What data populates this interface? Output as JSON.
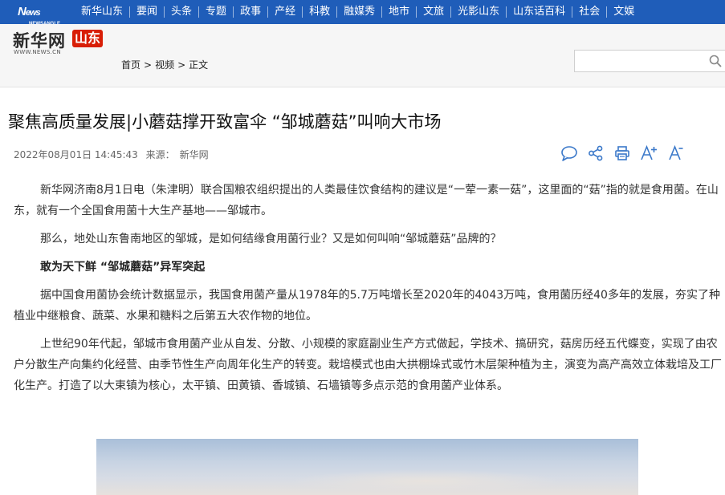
{
  "top_nav": {
    "logo": "NewsAngle",
    "items": [
      "新华山东",
      "要闻",
      "头条",
      "专题",
      "政事",
      "产经",
      "科教",
      "融媒秀",
      "地市",
      "文旅",
      "光影山东",
      "山东话百科",
      "社会",
      "文娱"
    ]
  },
  "header": {
    "brand_name": "新华网",
    "brand_region": "山东",
    "brand_url": "WWW.NEWS.CN",
    "breadcrumb": [
      "首页",
      "视频",
      "正文"
    ],
    "breadcrumb_sep": ">",
    "search_placeholder": ""
  },
  "article": {
    "title": "聚焦高质量发展|小蘑菇撑开致富伞 “邹城蘑菇”叫响大市场",
    "datetime": "2022年08月01日 14:45:43",
    "source_label": "来源：",
    "source": "新华网",
    "paragraphs": [
      {
        "text": "新华网济南8月1日电（朱津明）联合国粮农组织提出的人类最佳饮食结构的建议是“一荤一素一菇”，这里面的“菇”指的就是食用菌。在山东，就有一个全国食用菌十大生产基地——邹城市。",
        "bold": false
      },
      {
        "text": "那么，地处山东鲁南地区的邹城，是如何结缘食用菌行业？又是如何叫响“邹城蘑菇”品牌的？",
        "bold": false
      },
      {
        "text": "敢为天下鲜 “邹城蘑菇”异军突起",
        "bold": true
      },
      {
        "text": "据中国食用菌协会统计数据显示，我国食用菌产量从1978年的5.7万吨增长至2020年的4043万吨，食用菌历经40多年的发展，夯实了种植业中继粮食、蔬菜、水果和糖料之后第五大农作物的地位。",
        "bold": false
      },
      {
        "text": "上世纪90年代起，邹城市食用菌产业从自发、分散、小规模的家庭副业生产方式做起，学技术、搞研究，菇房历经五代蝶变，实现了由农户分散生产向集约化经营、由季节性生产向周年化生产的转变。栽培模式也由大拱棚垛式或竹木层架种植为主，演变为高产高效立体栽培及工厂化生产。打造了以大束镇为核心，太平镇、田黄镇、香城镇、石墙镇等多点示范的食用菌产业体系。",
        "bold": false
      }
    ]
  },
  "tools": [
    "comment-icon",
    "share-icon",
    "print-icon",
    "font-larger-icon",
    "font-smaller-icon"
  ],
  "colors": {
    "nav_bg": "#1f5db9",
    "brand_red": "#d81e06",
    "icon_blue": "#3a78c9"
  }
}
